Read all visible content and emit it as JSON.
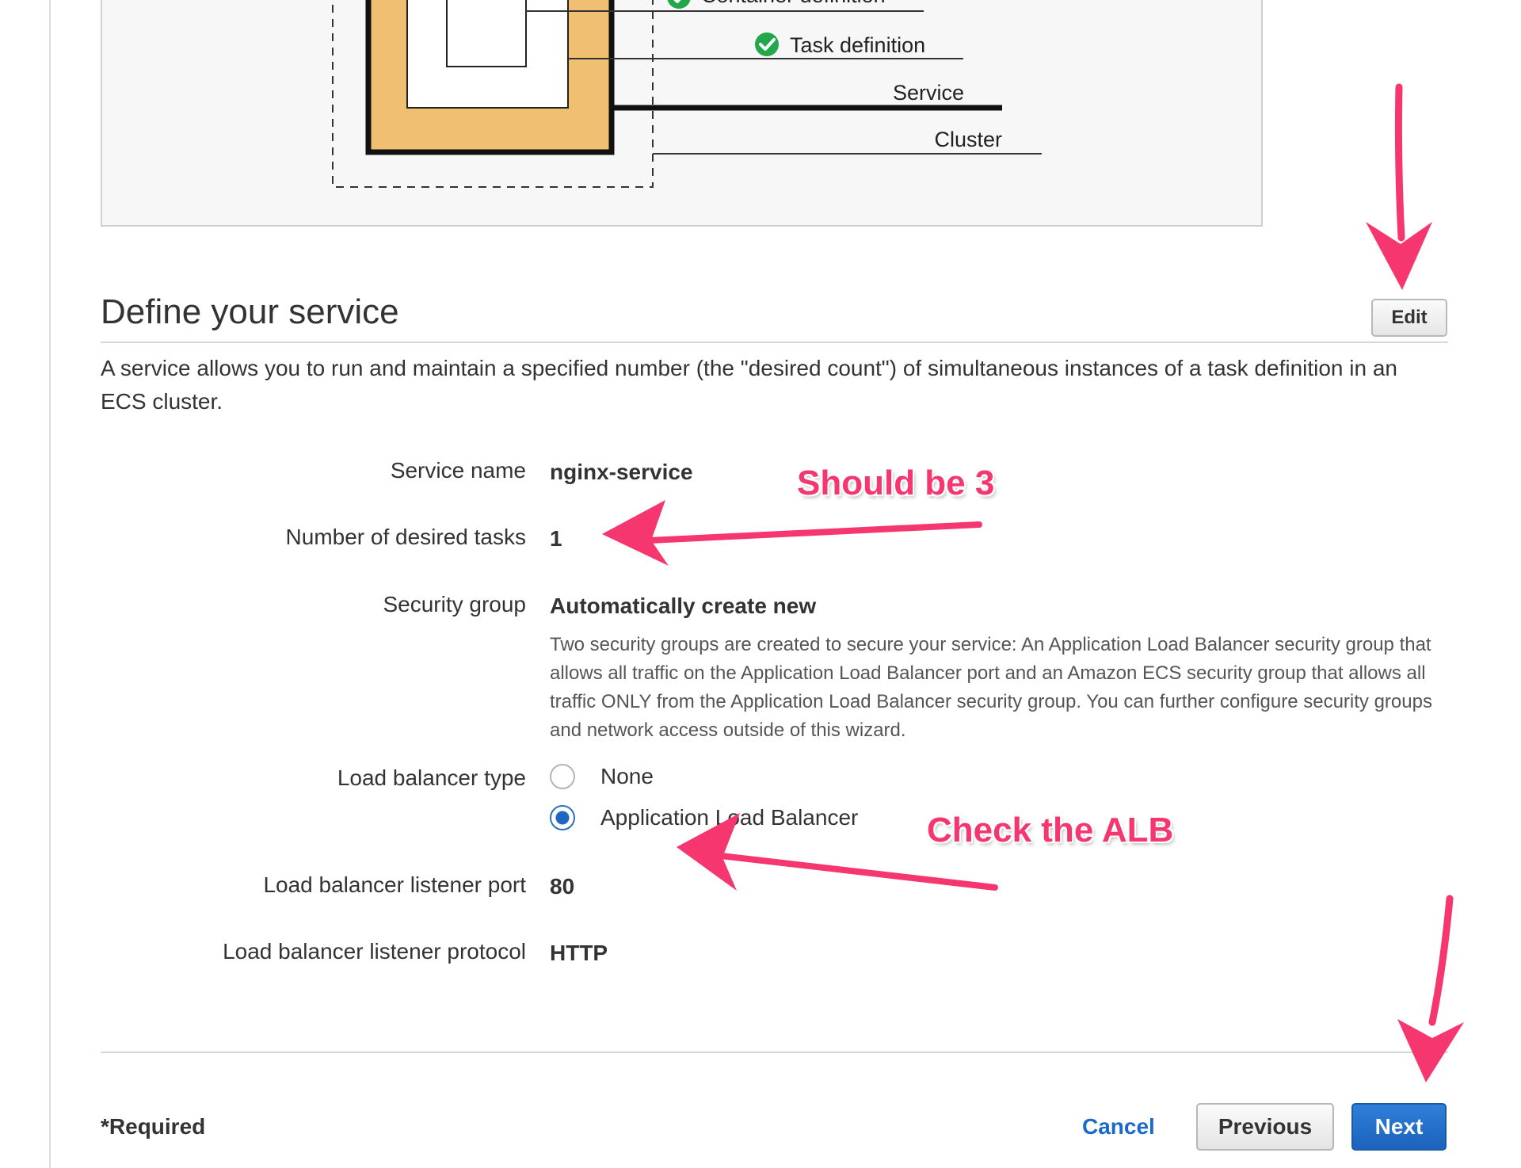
{
  "diagram": {
    "labels": {
      "container_definition": "Container definition",
      "task_definition": "Task definition",
      "service": "Service",
      "cluster": "Cluster"
    }
  },
  "section": {
    "title": "Define your service",
    "edit_label": "Edit",
    "description": "A service allows you to run and maintain a specified number (the \"desired count\") of simultaneous instances of a task definition in an ECS cluster."
  },
  "fields": {
    "service_name": {
      "label": "Service name",
      "value": "nginx-service"
    },
    "desired_tasks": {
      "label": "Number of desired tasks",
      "value": "1"
    },
    "security_group": {
      "label": "Security group",
      "value": "Automatically create new",
      "help": "Two security groups are created to secure your service: An Application Load Balancer security group that allows all traffic on the Application Load Balancer port and an Amazon ECS security group that allows all traffic ONLY from the Application Load Balancer security group. You can further configure security groups and network access outside of this wizard."
    },
    "load_balancer_type": {
      "label": "Load balancer type",
      "options": [
        {
          "label": "None",
          "selected": false
        },
        {
          "label": "Application Load Balancer",
          "selected": true
        }
      ]
    },
    "listener_port": {
      "label": "Load balancer listener port",
      "value": "80"
    },
    "listener_protocol": {
      "label": "Load balancer listener protocol",
      "value": "HTTP"
    }
  },
  "footer": {
    "required_note": "*Required",
    "cancel_label": "Cancel",
    "previous_label": "Previous",
    "next_label": "Next"
  },
  "annotations": {
    "should_be": "Should be 3",
    "check_alb": "Check the ALB",
    "color": "#f6366e"
  },
  "colors": {
    "primary_button": "#1b63bd",
    "link": "#1b6ac9",
    "check_green": "#22a84a",
    "diagram_fill": "#f1bf72"
  }
}
